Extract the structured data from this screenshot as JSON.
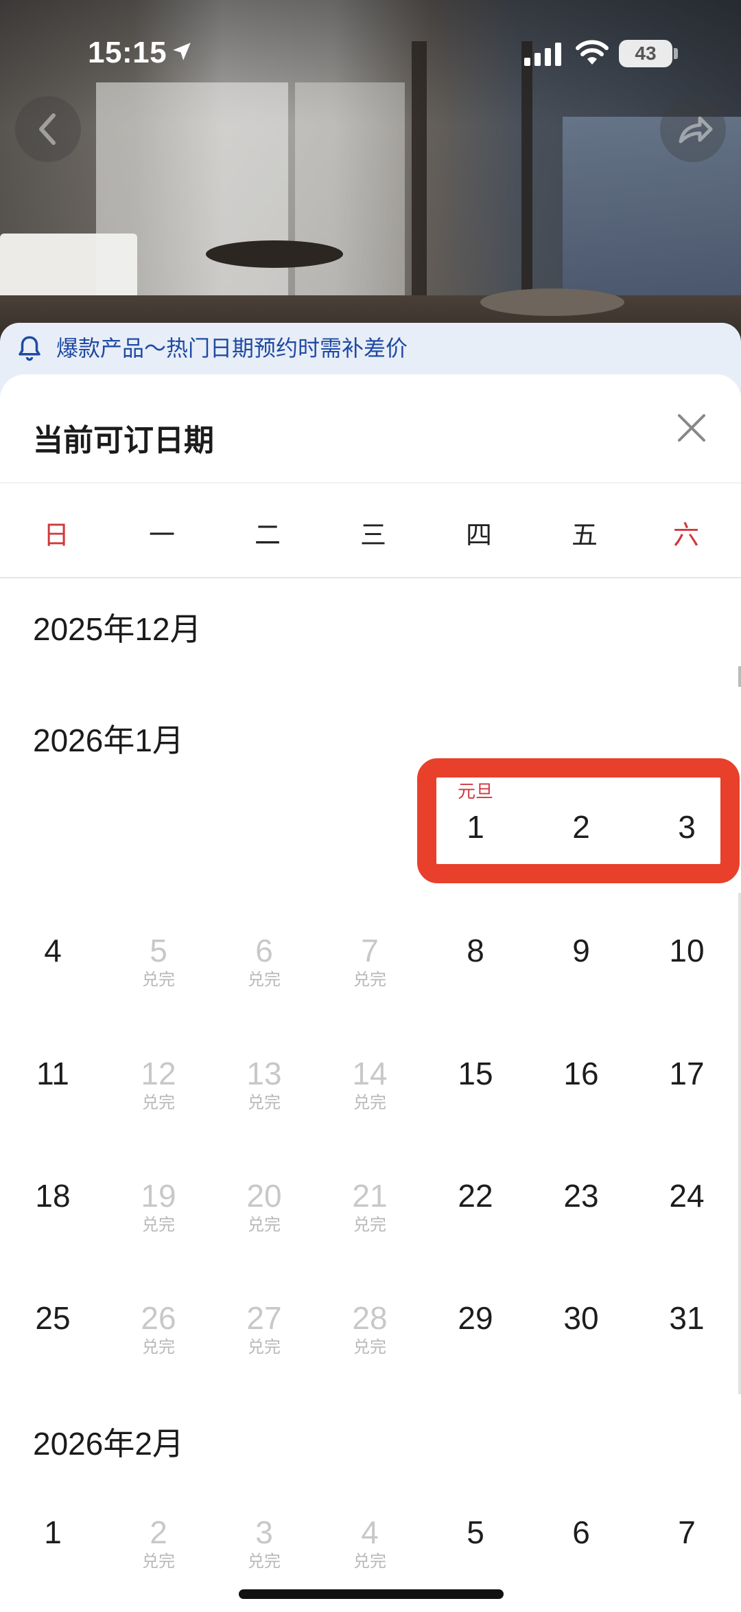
{
  "status": {
    "time": "15:15",
    "battery": "43"
  },
  "notice": {
    "text": "爆款产品～热门日期预约时需补差价"
  },
  "sheet": {
    "title": "当前可订日期"
  },
  "weekdays": [
    "日",
    "一",
    "二",
    "三",
    "四",
    "五",
    "六"
  ],
  "months": [
    {
      "title": "2025年12月"
    },
    {
      "title": "2026年1月"
    },
    {
      "title": "2026年2月"
    }
  ],
  "jan_holiday": "元旦",
  "soldout_label": "兑完",
  "january": [
    [
      "",
      "",
      "",
      "",
      "1",
      "2",
      "3"
    ],
    [
      "4",
      "5",
      "6",
      "7",
      "8",
      "9",
      "10"
    ],
    [
      "11",
      "12",
      "13",
      "14",
      "15",
      "16",
      "17"
    ],
    [
      "18",
      "19",
      "20",
      "21",
      "22",
      "23",
      "24"
    ],
    [
      "25",
      "26",
      "27",
      "28",
      "29",
      "30",
      "31"
    ]
  ],
  "february_first_week": [
    "1",
    "2",
    "3",
    "4",
    "5",
    "6",
    "7"
  ],
  "colors": {
    "accent_red": "#e8402b",
    "weekend_red": "#d0383d",
    "notice_blue": "#1f4aa3",
    "notice_bg": "#e8eef8"
  }
}
